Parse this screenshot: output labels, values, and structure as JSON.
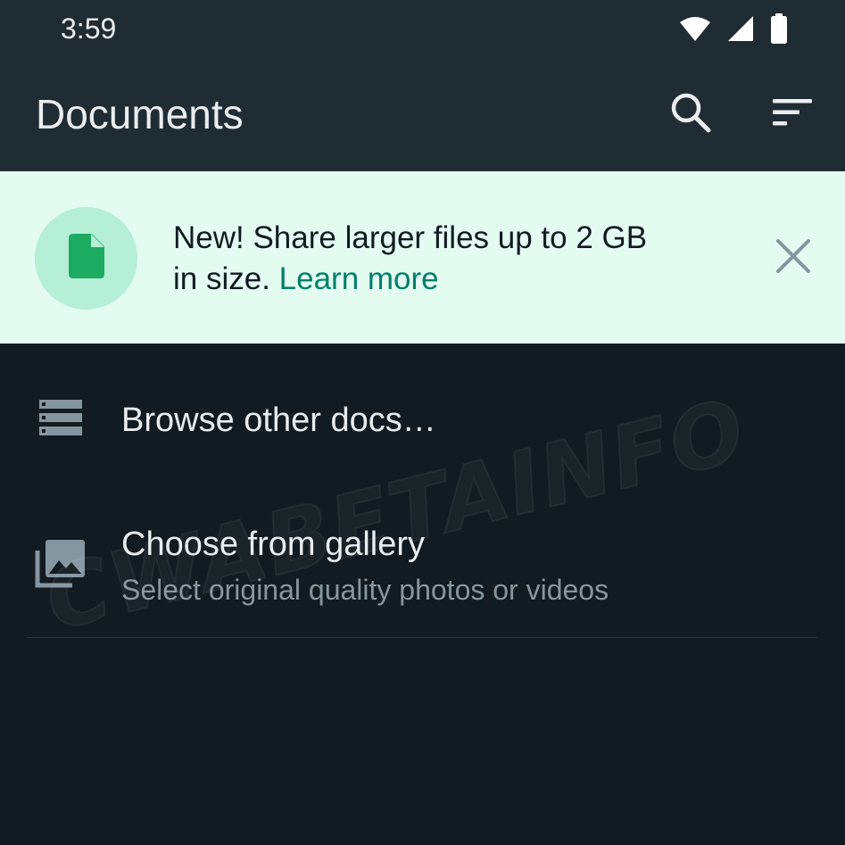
{
  "status_bar": {
    "time": "3:59",
    "icons": [
      "wifi-icon",
      "cell-signal-icon",
      "battery-icon"
    ]
  },
  "app_bar": {
    "title": "Documents",
    "actions": [
      "search-icon",
      "sort-icon"
    ]
  },
  "banner": {
    "text": "New! Share larger files up to 2 GB in size. ",
    "link_label": "Learn more",
    "icon": "document-icon",
    "close_icon": "close-icon"
  },
  "list": {
    "browse": {
      "label": "Browse other docs…",
      "icon": "storage-icon"
    },
    "gallery": {
      "label": "Choose from gallery",
      "sublabel": "Select original quality photos or videos",
      "icon": "gallery-icon"
    }
  },
  "watermark": "CWABETAINFO",
  "colors": {
    "background": "#111b21",
    "app_bar": "#202c33",
    "banner_bg": "#e3fbf1",
    "banner_badge": "#b5efd6",
    "accent": "#008069",
    "icon_green": "#1daa61",
    "primary_text": "#e9edef",
    "secondary_text": "#8696a0"
  }
}
